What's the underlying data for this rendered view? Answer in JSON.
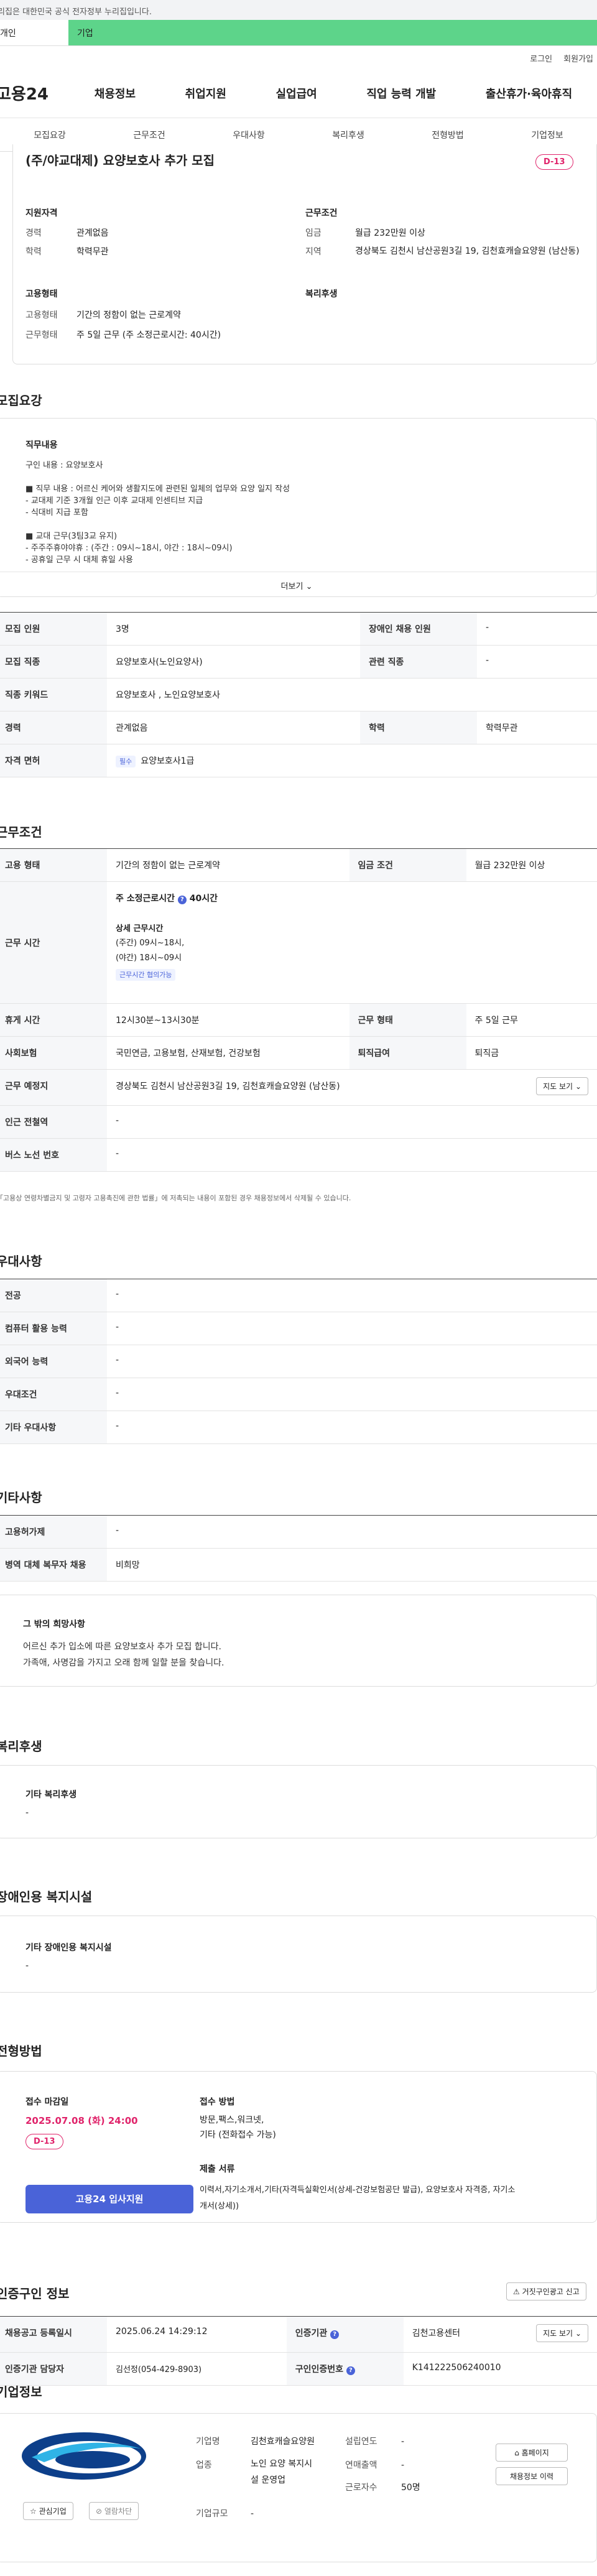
{
  "banner": {
    "text": "이 누리집은 대한민국 공식 전자정부 누리집입니다."
  },
  "tabs": {
    "personal": "개인",
    "company": "기업"
  },
  "util": {
    "login": "로그인",
    "join": "회원가입"
  },
  "gnb": {
    "logo": "고용24",
    "menu": [
      "채용정보",
      "취업지원",
      "실업급여",
      "직업 능력 개발",
      "출산휴가·육아휴직"
    ]
  },
  "subnav": [
    "모집요강",
    "근무조건",
    "우대사항",
    "복리후생",
    "전형방법",
    "기업정보"
  ],
  "summary": {
    "title": "(주/야교대제) 요양보호사 추가 모집",
    "dday": "D-13",
    "qual_title": "지원자격",
    "career_label": "경력",
    "career": "관계없음",
    "edu_label": "학력",
    "edu": "학력무관",
    "cond_title": "근무조건",
    "wage_label": "임금",
    "wage": "월급 232만원 이상",
    "area_label": "지역",
    "area": "경상북도 김천시 남산공원3길 19, 김천효캐슬요양원 (남산동)",
    "emp_title": "고용형태",
    "emptype_label": "고용형태",
    "emptype": "기간의 정함이 없는 근로계약",
    "worktype_label": "근무형태",
    "worktype": "주 5일 근무 (주 소정근로시간: 40시간)",
    "welfare_title": "복리후생"
  },
  "recruit": {
    "title": "모집요강",
    "duty_title": "직무내용",
    "duty_lines": [
      "구인 내용 : 요양보호사",
      "",
      "■ 직무 내용 : 어르신 케어와 생활지도에 관련된 일체의 업무와 요양 일지 작성",
      "- 교대제 기준 3개월 인근 이후 교대제 인센티브 지급",
      "- 식대비 지급 포함",
      "",
      "■ 교대 근무(3팀3교 유지)",
      "- 주주주휴야야휴 : (주간 : 09시~18시, 야간 : 18시~09시)",
      "- 공휴일 근무 시 대체 휴일 사용"
    ],
    "more": "더보기",
    "rows": [
      {
        "h1": "모집 인원",
        "v1": "3명",
        "h2": "장애인 채용 인원",
        "v2": "-"
      },
      {
        "h1": "모집 직종",
        "v1": "요양보호사(노인요양사)",
        "h2": "관련 직종",
        "v2": "-"
      },
      {
        "h1": "직종 키워드",
        "v1": "요양보호사 , 노인요양보호사"
      },
      {
        "h1": "경력",
        "v1": "관계없음",
        "h2": "학력",
        "v2": "학력무관"
      },
      {
        "h1": "자격 면허",
        "tag": "필수",
        "v1": "요양보호사1급"
      }
    ]
  },
  "work": {
    "title": "근무조건",
    "emp_h": "고용 형태",
    "emp_v": "기간의 정함이 없는 근로계약",
    "wage_h": "임금 조건",
    "wage_v": "월급 232만원 이상",
    "time_h": "근무 시간",
    "weekly": "주 소정근로시간",
    "weekly_v": "40시간",
    "detail_title": "상세 근무시간",
    "detail_lines": [
      "(주간) 09시~18시,",
      "(야간) 18시~09시"
    ],
    "shift_tag": "근무시간 협의가능",
    "break_h": "휴게 시간",
    "break_v": "12시30분~13시30분",
    "form_h": "근무 형태",
    "form_v": "주 5일 근무",
    "ins_h": "사회보험",
    "ins_v": "국민연금, 고용보험, 산재보험, 건강보험",
    "sev_h": "퇴직급여",
    "sev_v": "퇴직금",
    "place_h": "근무 예정지",
    "place_v": "경상북도 김천시 남산공원3길 19, 김천효캐슬요양원 (남산동)",
    "map_btn": "지도 보기",
    "subway_h": "인근 전철역",
    "subway_v": "-",
    "bus_h": "버스 노선 번호",
    "bus_v": "-",
    "note": "「고용상 연령차별금지 및 고령자 고용촉진에 관한 법률」에 저촉되는 내용이 포함된 경우 채용정보에서 삭제될 수 있습니다."
  },
  "pref": {
    "title": "우대사항",
    "rows": [
      {
        "h": "전공",
        "v": "-"
      },
      {
        "h": "컴퓨터 활용 능력",
        "v": "-"
      },
      {
        "h": "외국어 능력",
        "v": "-"
      },
      {
        "h": "우대조건",
        "v": "-"
      },
      {
        "h": "기타 우대사항",
        "v": "-"
      }
    ]
  },
  "etc": {
    "title": "기타사항",
    "rows": [
      {
        "h": "고용허가제",
        "v": "-"
      },
      {
        "h": "병역 대체 복무자 채용",
        "v": "비희망"
      }
    ],
    "box_title": "그 밖의 희망사항",
    "box_lines": [
      "어르신 추가 입소에 따른 요양보호사 추가 모집 합니다.",
      "가족애, 사명감을 가지고 오래 함께 일할 분을 찾습니다."
    ]
  },
  "welfare": {
    "title": "복리후생",
    "box_title": "기타 복리후생",
    "box_v": "-"
  },
  "disabled": {
    "title": "장애인용 복지시설",
    "box_title": "기타 장애인용 복지시설",
    "box_v": "-"
  },
  "apply": {
    "title": "전형방법",
    "deadline_title": "접수 마감일",
    "deadline": "2025.07.08 (화) 24:00",
    "dday": "D-13",
    "apply_btn": "고용24 입사지원",
    "method_title": "접수 방법",
    "method_lines": [
      "방문,팩스,워크넷,",
      "기타 (전화접수 가능)"
    ],
    "docs_title": "제출 서류",
    "docs_lines": [
      "이력서,자기소개서,기타(자격득실확인서(상세-건강보험공단 발급), 요양보호사 자격증, 자기소",
      "개서(상세))"
    ]
  },
  "cert": {
    "title": "인증구인 정보",
    "report_btn": "거짓구인광고 신고",
    "reg_h": "채용공고 등록일시",
    "reg_v": "2025.06.24 14:29:12",
    "agency_h": "인증기관",
    "agency_v": "김천고용센터",
    "map_btn": "지도 보기",
    "manager_h": "인증기관 담당자",
    "manager_v": "김선정(054-429-8903)",
    "no_h": "구인인증번호",
    "no_v": "K141222506240010"
  },
  "company": {
    "title": "기업정보",
    "fav_btn": "관심기업",
    "block_btn": "열람차단",
    "name_label": "기업명",
    "name": "김천효캐슬요양원",
    "biz_label": "업종",
    "biz_lines": [
      "노인 요양 복지시",
      "설 운영업"
    ],
    "size_label": "기업규모",
    "size": "-",
    "est_label": "설립연도",
    "est": "-",
    "sales_label": "연매출액",
    "sales": "-",
    "emp_label": "근로자수",
    "emp": "50명",
    "home_btn": "홈페이지",
    "jobs_btn": "채용정보 이력"
  }
}
